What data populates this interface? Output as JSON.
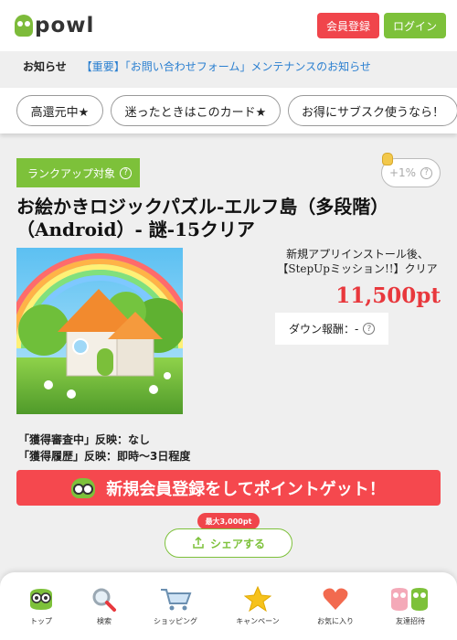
{
  "header": {
    "logo_text": "powl",
    "register_label": "会員登録",
    "login_label": "ログイン"
  },
  "news": {
    "label": "お知らせ",
    "link_text": "【重要】「お問い合わせフォーム」メンテナンスのお知らせ"
  },
  "chips": [
    {
      "label": "高還元中★"
    },
    {
      "label": "迷ったときはこのカード★"
    },
    {
      "label": "お得にサブスク使うなら！"
    }
  ],
  "offer": {
    "rank_badge": "ランクアップ対象",
    "bonus": "+1%",
    "title": "お絵かきロジックパズル-エルフ島（多段階）（Android）- 謎-15クリア",
    "condition_line1": "新規アプリインストール後、",
    "condition_line2": "【StepUpミッション!!】クリア",
    "points": "11,500pt",
    "down_reward": "ダウン報酬：-",
    "reflect_pending": "「獲得審査中」反映：なし",
    "reflect_history": "「獲得履歴」反映：即時～3日程度",
    "cta": "新規会員登録をしてポイントゲット！",
    "share_tag": "最大3,000pt",
    "share_label": "シェアする"
  },
  "bottom_nav": [
    {
      "label": "トップ",
      "icon": "owl-icon"
    },
    {
      "label": "検索",
      "icon": "search-icon"
    },
    {
      "label": "ショッピング",
      "icon": "cart-icon"
    },
    {
      "label": "キャンペーン",
      "icon": "star-icon"
    },
    {
      "label": "お気に入り",
      "icon": "heart-icon"
    },
    {
      "label": "友達招待",
      "icon": "friends-icon"
    }
  ],
  "colors": {
    "brand_green": "#7dc13a",
    "brand_red": "#f0454b",
    "link_blue": "#2a7fd0"
  }
}
